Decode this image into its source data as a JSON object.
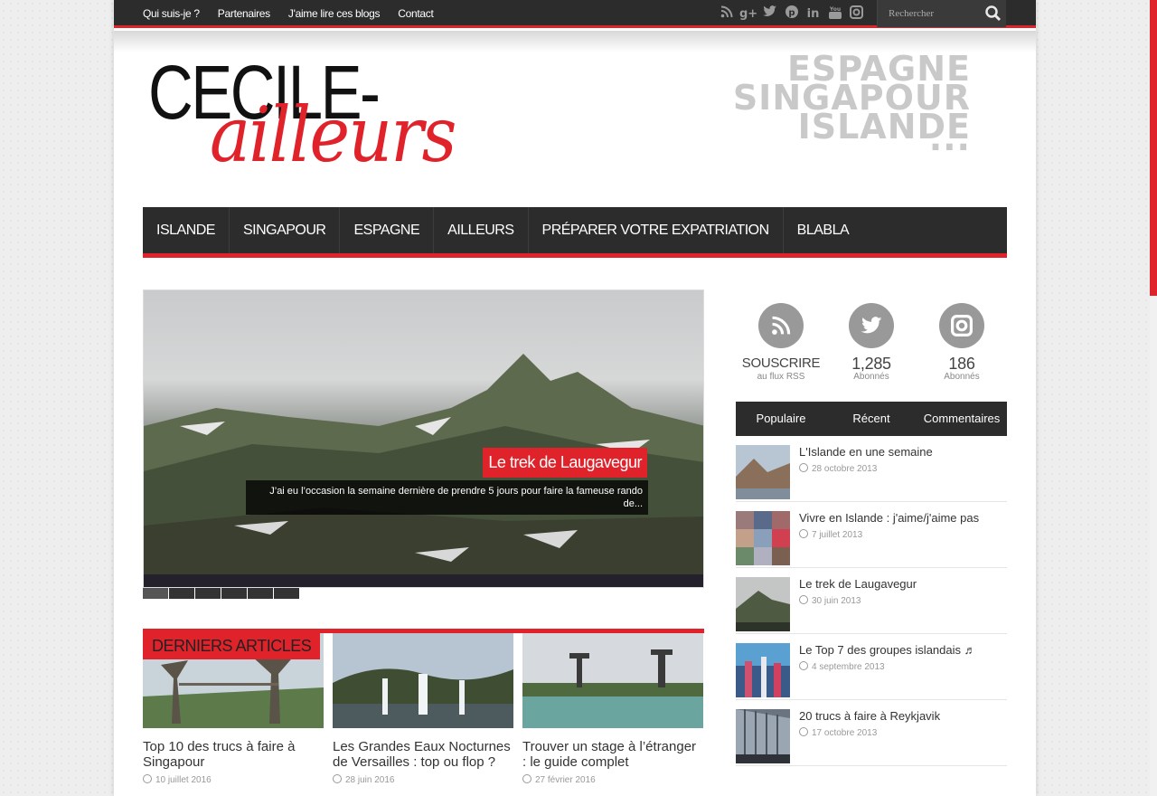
{
  "topnav": [
    "Qui suis-je ?",
    "Partenaires",
    "J'aime lire ces blogs",
    "Contact"
  ],
  "topbar": {
    "social_icons": [
      "rss-icon",
      "google-plus-icon",
      "twitter-icon",
      "pinterest-icon",
      "linkedin-icon",
      "youtube-icon",
      "instagram-icon"
    ],
    "search_placeholder": "Rechercher"
  },
  "logo": {
    "part1": "CECILE-",
    "part2": "ailleurs"
  },
  "banner": [
    "ESPAGNE",
    "SINGAPOUR",
    "ISLANDE",
    "..."
  ],
  "mainnav": [
    "ISLANDE",
    "SINGAPOUR",
    "ESPAGNE",
    "AILLEURS",
    "PRÉPARER VOTRE EXPATRIATION",
    "BLABLA"
  ],
  "slider": {
    "title": "Le trek de Laugavegur",
    "excerpt": "J’ai eu l’occasion la semaine dernière de prendre 5 jours pour faire la fameuse rando de...",
    "dots": 6
  },
  "recent": {
    "title": "DERNIERS ARTICLES",
    "articles": [
      {
        "title": "Top 10 des trucs à faire à Singapour",
        "date": "10 juillet 2016"
      },
      {
        "title": "Les Grandes Eaux Nocturnes de Versailles : top ou flop ?",
        "date": "28 juin 2016"
      },
      {
        "title": "Trouver un stage à l’étranger : le guide complet",
        "date": "27 février 2016"
      }
    ]
  },
  "sidebar": {
    "counters": [
      {
        "icon": "rss-icon",
        "num": "SOUSCRIRE",
        "label": "au flux RSS"
      },
      {
        "icon": "twitter-icon",
        "num": "1,285",
        "label": "Abonnés"
      },
      {
        "icon": "instagram-icon",
        "num": "186",
        "label": "Abonnés"
      }
    ],
    "tabs": [
      "Populaire",
      "Récent",
      "Commentaires"
    ],
    "posts": [
      {
        "title": "L'Islande en une semaine",
        "date": "28 octobre 2013"
      },
      {
        "title": "Vivre en Islande : j'aime/j'aime pas",
        "date": "7 juillet 2013"
      },
      {
        "title": "Le trek de Laugavegur",
        "date": "30 juin 2013"
      },
      {
        "title": "Le Top 7 des groupes islandais ♬",
        "date": "4 septembre 2013"
      },
      {
        "title": "20 trucs à faire à Reykjavik",
        "date": "17 octobre 2013"
      }
    ]
  },
  "colors": {
    "accent": "#e0222b",
    "dark": "#2c2c2c"
  }
}
